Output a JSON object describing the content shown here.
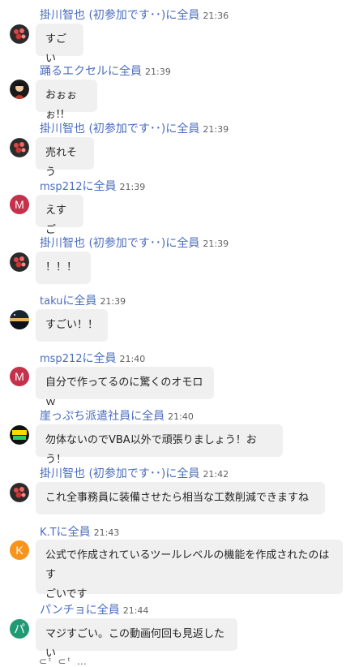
{
  "messages": [
    {
      "sender": "掛川智也 (初参加です･･)",
      "mention": "に全員",
      "time": "21:36",
      "text": "すごい",
      "avatar": "photo-avatar"
    },
    {
      "sender": "踊るエクセル",
      "mention": "に全員",
      "time": "21:39",
      "text": "おぉぉぉ!!",
      "avatar": "photo-avatar"
    },
    {
      "sender": "掛川智也 (初参加です･･)",
      "mention": "に全員",
      "time": "21:39",
      "text": "売れそう",
      "avatar": "photo-avatar"
    },
    {
      "sender": "msp212",
      "mention": "に全員",
      "time": "21:39",
      "text": "えすご",
      "avatar_letter": "M"
    },
    {
      "sender": "掛川智也 (初参加です･･)",
      "mention": "に全員",
      "time": "21:39",
      "text": "！！！",
      "avatar": "photo-avatar"
    },
    {
      "sender": "taku",
      "mention": "に全員",
      "time": "21:39",
      "text": "すごい！！",
      "avatar": "photo-avatar"
    },
    {
      "sender": "msp212",
      "mention": "に全員",
      "time": "21:40",
      "text": "自分で作ってるのに驚くのオモロｗ",
      "avatar_letter": "M"
    },
    {
      "sender": "崖っぷち派遣社員",
      "mention": "に全員",
      "time": "21:40",
      "text": "勿体ないのでVBA以外で頑張りましょう！おう！",
      "avatar": "photo-avatar"
    },
    {
      "sender": "掛川智也 (初参加です･･)",
      "mention": "に全員",
      "time": "21:42",
      "text": "これ全事務員に装備させたら相当な工数削減できますね",
      "avatar": "photo-avatar"
    },
    {
      "sender": "K.T",
      "mention": "に全員",
      "time": "21:43",
      "text_line1": "公式で作成されているツールレベルの機能を作成されたのはす",
      "text_line2": "ごいです",
      "avatar_letter": "K"
    },
    {
      "sender": "パンチョ",
      "mention": "に全員",
      "time": "21:44",
      "text": "マジすごい。この動画何回も見返したい",
      "avatar_letter": "パ"
    }
  ],
  "footer": "⊂ᵗ ⊂ᵗ …"
}
